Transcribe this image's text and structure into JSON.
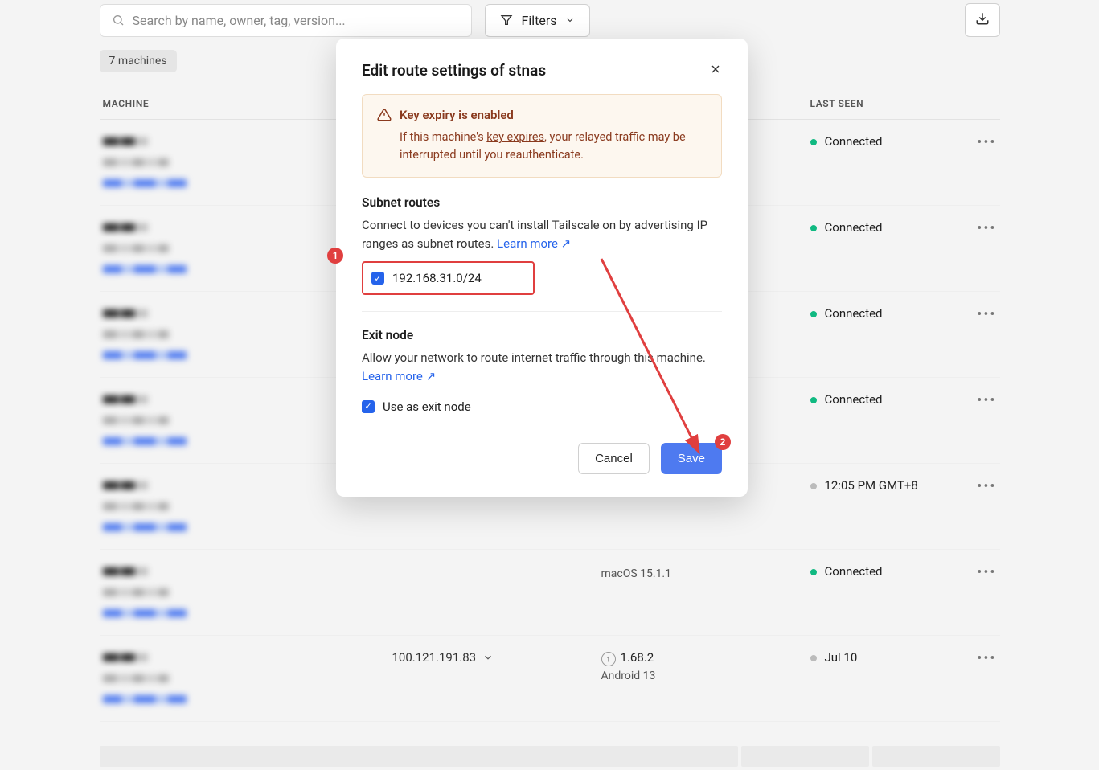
{
  "search": {
    "placeholder": "Search by name, owner, tag, version..."
  },
  "filters_label": "Filters",
  "machine_count_chip": "7 machines",
  "columns": {
    "machine": "MACHINE",
    "last_seen": "LAST SEEN"
  },
  "rows": [
    {
      "status": "green",
      "status_text": "Connected",
      "addr": "",
      "version": "",
      "sub": "",
      "blurred": true
    },
    {
      "status": "green",
      "status_text": "Connected",
      "addr": "",
      "version": "",
      "sub": "",
      "blurred": true
    },
    {
      "status": "green",
      "status_text": "Connected",
      "addr": "",
      "version": "",
      "sub": "a+truenas",
      "blurred": true
    },
    {
      "status": "green",
      "status_text": "Connected",
      "addr": "",
      "version": "",
      "sub": "c",
      "blurred": true
    },
    {
      "status": "gray",
      "status_text": "12:05 PM GMT+8",
      "addr": "",
      "version": "",
      "sub": "",
      "blurred": true
    },
    {
      "status": "green",
      "status_text": "Connected",
      "addr": "",
      "version": "",
      "sub": "macOS 15.1.1",
      "blurred": true
    },
    {
      "status": "gray",
      "status_text": "Jul 10",
      "addr": "100.121.191.83",
      "version": "1.68.2",
      "sub": "Android 13",
      "blurred": true
    }
  ],
  "modal": {
    "title": "Edit route settings of stnas",
    "warn": {
      "title": "Key expiry is enabled",
      "body_prefix": "If this machine's ",
      "link_text": "key expires",
      "body_suffix": ", your relayed traffic may be interrupted until you reauthenticate."
    },
    "subnet": {
      "title": "Subnet routes",
      "desc_prefix": "Connect to devices you can't install Tailscale on by advertising IP ranges as subnet routes. ",
      "learn_more": "Learn more ↗",
      "route": "192.168.31.0/24"
    },
    "exit": {
      "title": "Exit node",
      "desc_prefix": "Allow your network to route internet traffic through this machine. ",
      "learn_more": "Learn more ↗",
      "checkbox_label": "Use as exit node"
    },
    "cancel": "Cancel",
    "save": "Save"
  },
  "annotations": {
    "badge1": "1",
    "badge2": "2"
  }
}
